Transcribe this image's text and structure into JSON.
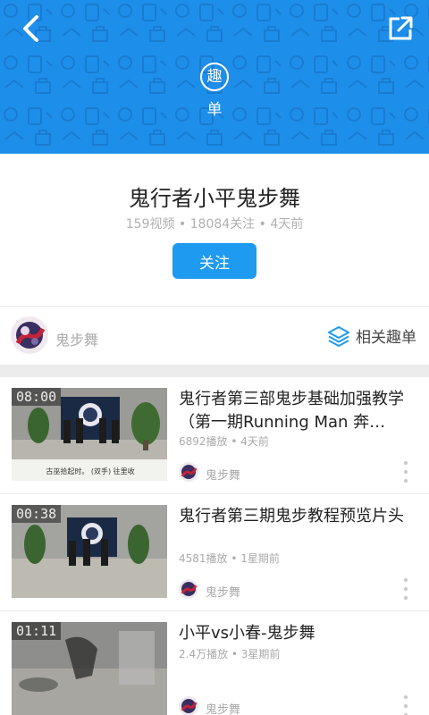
{
  "colors": {
    "brand": "#1E8EEB",
    "button": "#1E9AF0",
    "divider": "#ececec"
  },
  "header": {
    "back_icon": "chevron-left-icon",
    "share_icon": "share-external-icon",
    "badge_char": "趣",
    "badge_sub": "单"
  },
  "playlist": {
    "title": "鬼行者小平鬼步舞",
    "meta": "159视频 • 18084关注 • 4天前",
    "follow_label": "关注"
  },
  "author": {
    "name": "鬼步舞",
    "related_label": "相关趣单",
    "related_icon": "layers-icon"
  },
  "videos": [
    {
      "duration": "08:00",
      "title": "鬼行者第三部鬼步基础加强教学（第一期Running Man 奔…",
      "meta": "6892播放 • 4天前",
      "author": "鬼步舞",
      "caption": "古巫拾起时。 (双手) 往里收"
    },
    {
      "duration": "00:38",
      "title": "鬼行者第三期鬼步教程预览片头",
      "meta": "4581播放 • 1星期前",
      "author": "鬼步舞"
    },
    {
      "duration": "01:11",
      "title": "小平vs小春-鬼步舞",
      "meta": "2.4万播放 • 3星期前",
      "author": "鬼步舞"
    }
  ]
}
